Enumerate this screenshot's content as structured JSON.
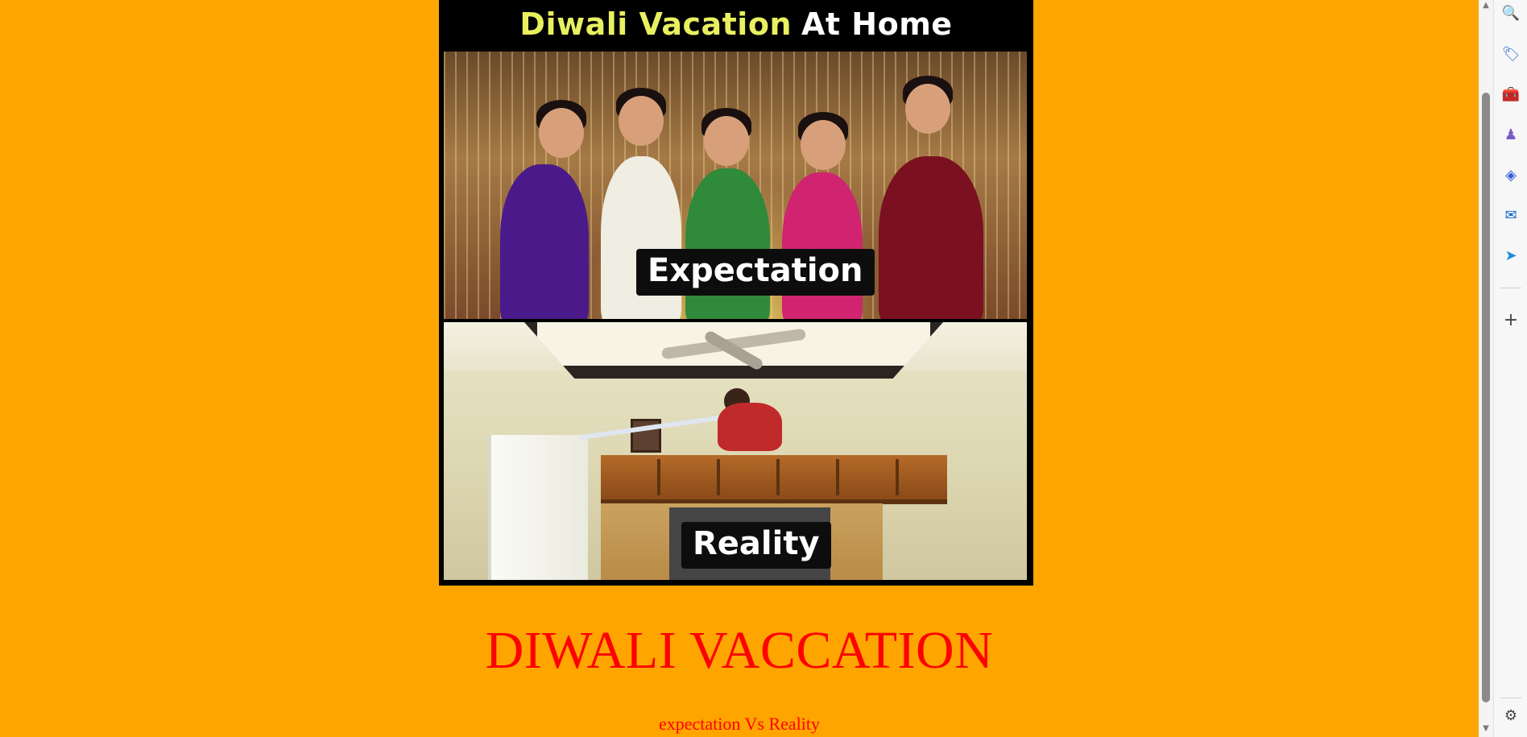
{
  "page": {
    "background": "#ffa500",
    "heading": "DIWALI VACCATION",
    "subheading": "expectation Vs Reality",
    "text_color": "#ff0000"
  },
  "meme": {
    "title_part1": "Diwali Vacation",
    "title_part2": "At Home",
    "caption_top": "Expectation",
    "caption_bottom": "Reality"
  },
  "scrollbar": {
    "up_arrow": "▲",
    "down_arrow": "▼"
  },
  "sidebar": {
    "items": [
      {
        "icon": "search-icon",
        "glyph": "🔍",
        "color": "#555555"
      },
      {
        "icon": "tag-icon",
        "glyph": "🏷",
        "color": "#2f6fd6"
      },
      {
        "icon": "toolbox-icon",
        "glyph": "🧰",
        "color": "#d04020"
      },
      {
        "icon": "games-icon",
        "glyph": "♟",
        "color": "#7a5cc8"
      },
      {
        "icon": "copilot-icon",
        "glyph": "◈",
        "color": "#3a5fd8"
      },
      {
        "icon": "outlook-icon",
        "glyph": "✉",
        "color": "#0a64c8"
      },
      {
        "icon": "send-icon",
        "glyph": "➤",
        "color": "#1e8fd8"
      }
    ],
    "add_glyph": "+",
    "settings_glyph": "⚙"
  }
}
